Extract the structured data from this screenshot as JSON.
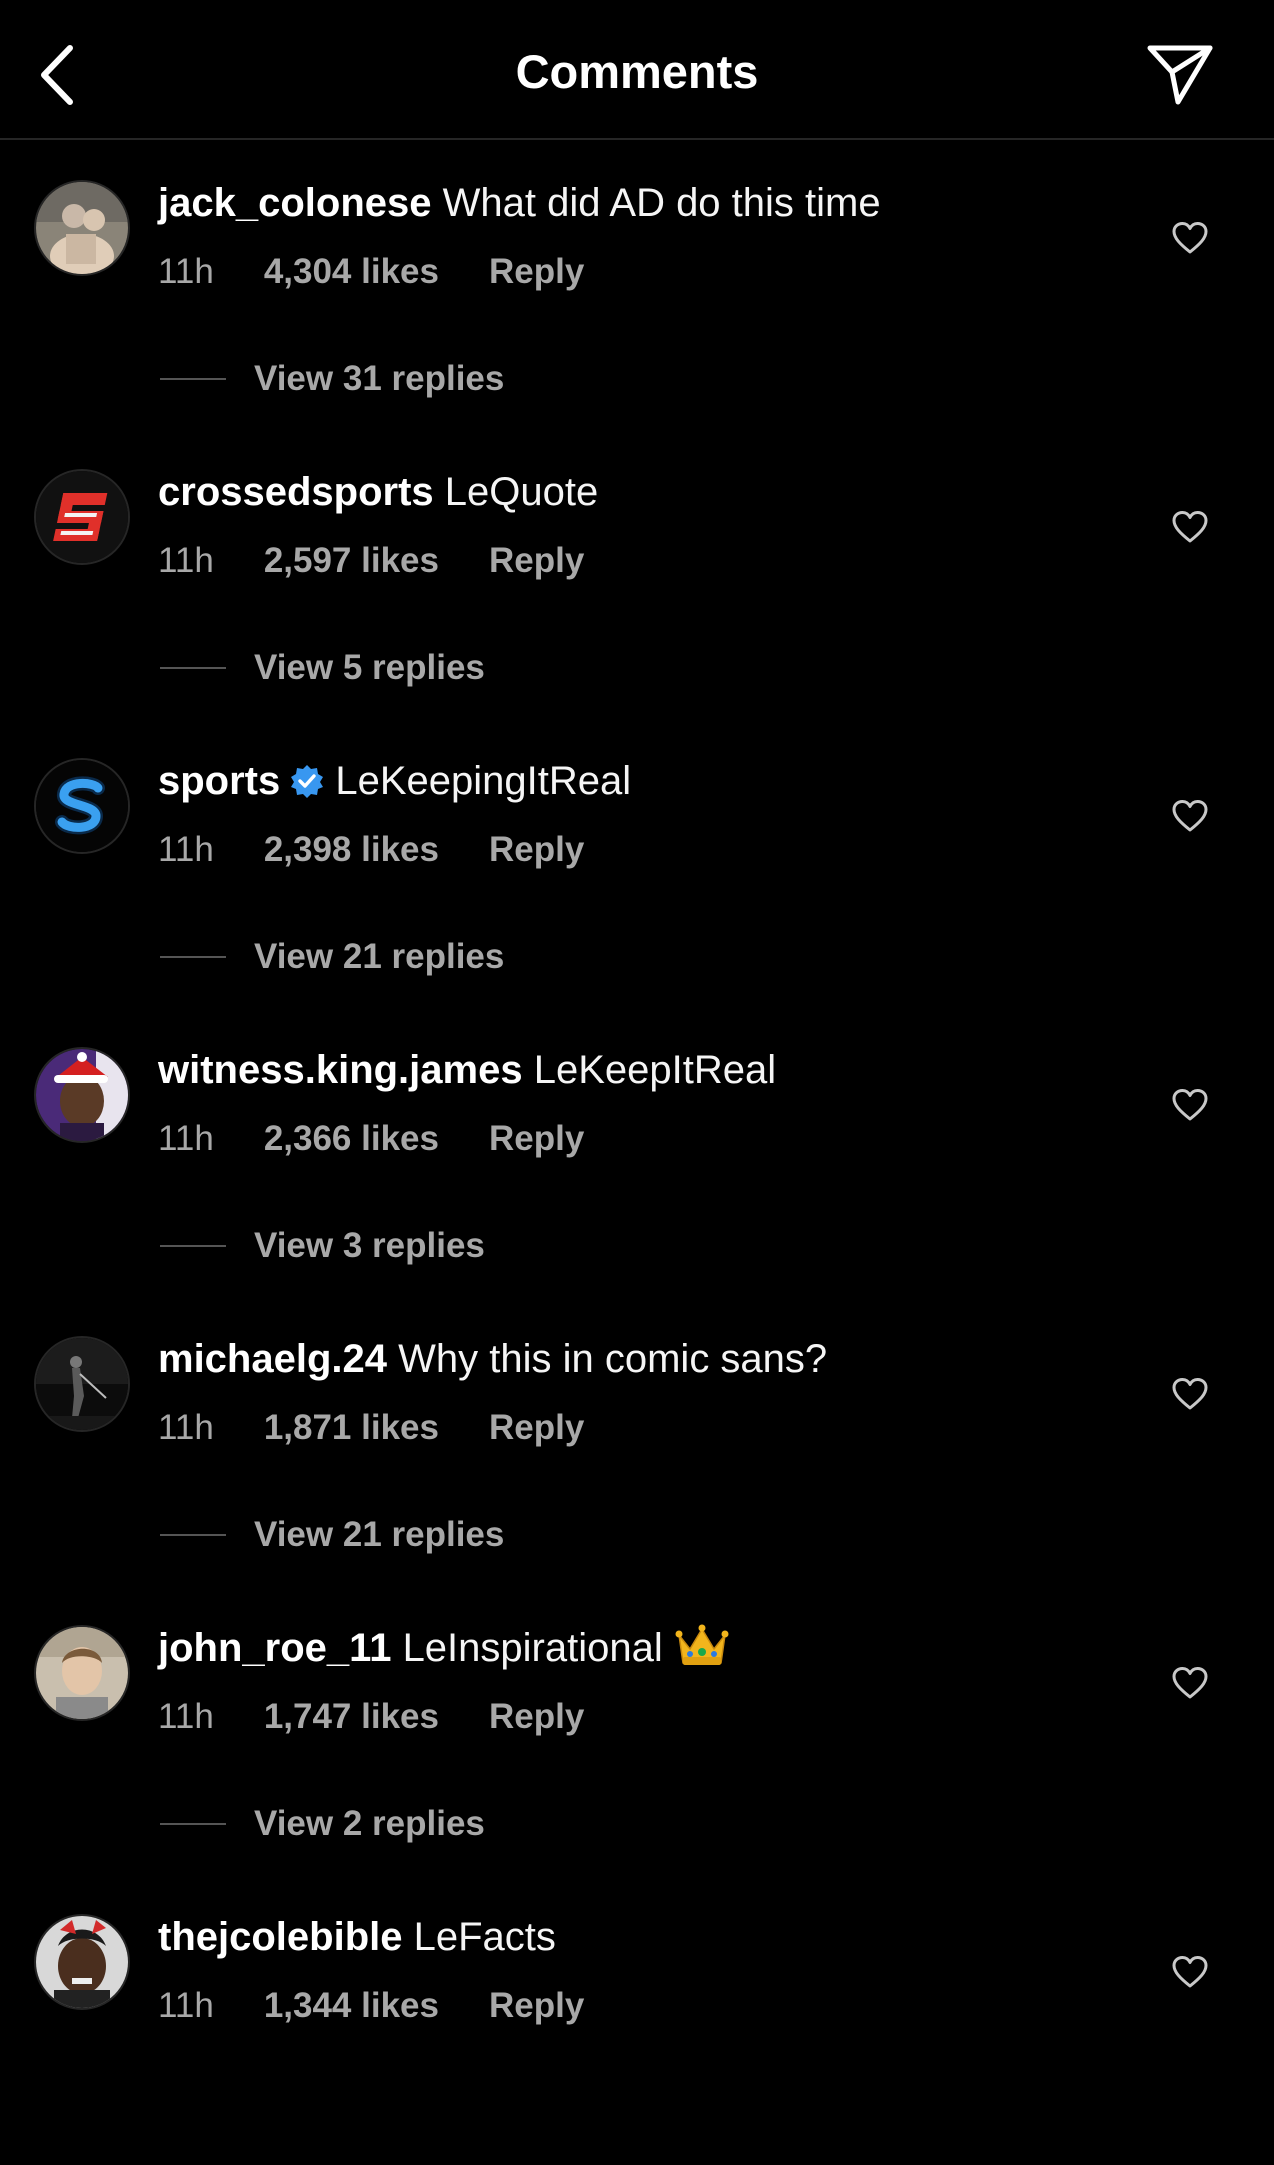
{
  "header": {
    "title": "Comments",
    "back_icon": "chevron-left-icon",
    "share_icon": "paper-plane-icon"
  },
  "comments": [
    {
      "username": "jack_colonese",
      "verified": false,
      "text": "What did AD do this time",
      "time": "11h",
      "likes": "4,304 likes",
      "reply": "Reply",
      "view_replies": "View 31 replies"
    },
    {
      "username": "crossedsports",
      "verified": false,
      "text": "LeQuote",
      "time": "11h",
      "likes": "2,597 likes",
      "reply": "Reply",
      "view_replies": "View 5 replies"
    },
    {
      "username": "sports",
      "verified": true,
      "text": "LeKeepingItReal",
      "time": "11h",
      "likes": "2,398 likes",
      "reply": "Reply",
      "view_replies": "View 21 replies"
    },
    {
      "username": "witness.king.james",
      "verified": false,
      "text": "LeKeepItReal",
      "time": "11h",
      "likes": "2,366 likes",
      "reply": "Reply",
      "view_replies": "View 3 replies"
    },
    {
      "username": "michaelg.24",
      "verified": false,
      "text": "Why this in comic sans?",
      "time": "11h",
      "likes": "1,871 likes",
      "reply": "Reply",
      "view_replies": "View 21 replies"
    },
    {
      "username": "john_roe_11",
      "verified": false,
      "text": "LeInspirational",
      "emoji": "crown",
      "time": "11h",
      "likes": "1,747 likes",
      "reply": "Reply",
      "view_replies": "View 2 replies"
    },
    {
      "username": "thejcolebible",
      "verified": false,
      "text": "LeFacts",
      "time": "11h",
      "likes": "1,344 likes",
      "reply": "Reply"
    }
  ],
  "colors": {
    "background": "#000000",
    "primary_text": "#f5f5f5",
    "secondary_text": "#a8a8a8",
    "divider": "#262626",
    "verified_blue": "#3897f0"
  }
}
